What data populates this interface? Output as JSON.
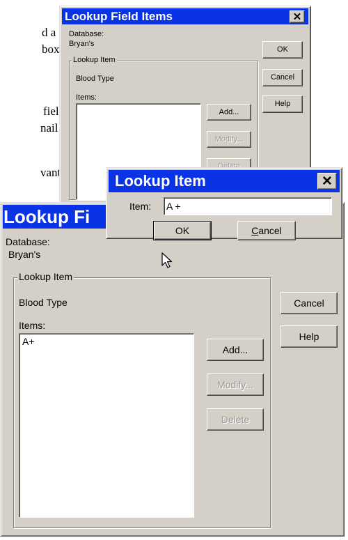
{
  "document": {
    "lines": [
      "d a",
      "box",
      "field",
      "nail",
      "vant"
    ]
  },
  "back_dialog": {
    "title": "Lookup Field Items",
    "database_label": "Database:",
    "database_value": "Bryan's",
    "group_label": "Lookup Item",
    "field_name": "Blood Type",
    "items_label": "Items:",
    "ok_label": "OK",
    "cancel_label": "Cancel",
    "help_label": "Help",
    "add_label": "Add...",
    "modify_label": "Modify...",
    "delete_label": "Delete"
  },
  "item_dialog": {
    "title": "Lookup Item",
    "item_label": "Item:",
    "item_value": "A +",
    "ok_label": "OK",
    "cancel_label": "Cancel"
  },
  "front_dialog": {
    "title_visible": "Lookup Fi",
    "database_label": "Database:",
    "database_value": "Bryan's",
    "group_label": "Lookup Item",
    "field_name": "Blood Type",
    "items_label": "Items:",
    "items": [
      "A+"
    ],
    "cancel_label": "Cancel",
    "help_label": "Help",
    "add_label": "Add...",
    "modify_label": "Modify...",
    "delete_label": "Delete"
  },
  "icons": {
    "close": "close-icon",
    "cursor": "mouse-cursor-icon"
  },
  "colors": {
    "title_bar": "#0a33e6",
    "dialog_face": "#d4d0c8"
  }
}
